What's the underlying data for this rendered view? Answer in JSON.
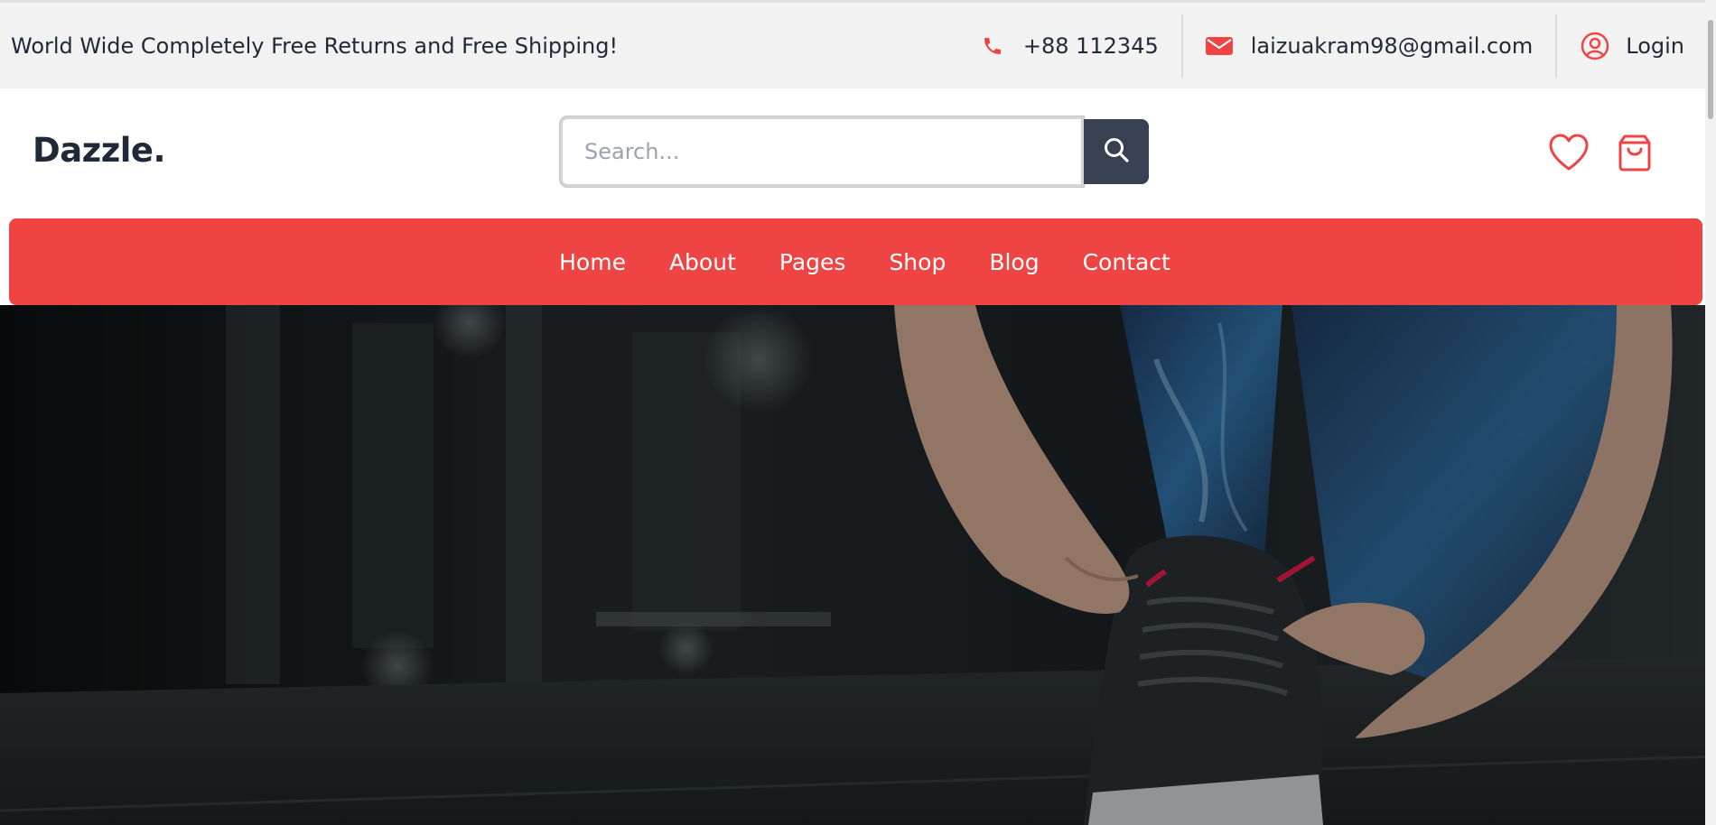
{
  "topbar": {
    "announcement": "World Wide Completely Free Returns and Free Shipping!",
    "phone": {
      "icon": "phone-icon",
      "text": "+88 112345"
    },
    "email": {
      "icon": "envelope-icon",
      "text": "laizuakram98@gmail.com"
    },
    "login": {
      "icon": "user-circle-icon",
      "label": "Login"
    }
  },
  "header": {
    "logo": "Dazzle.",
    "search": {
      "placeholder": "Search...",
      "value": "",
      "button_icon": "search-icon"
    },
    "icons": [
      "heart-icon",
      "shopping-bag-icon"
    ]
  },
  "nav": {
    "items": [
      "Home",
      "About",
      "Pages",
      "Shop",
      "Blog",
      "Contact"
    ]
  },
  "hero": {
    "image": "photo-person-tying-sneaker-laces"
  },
  "colors": {
    "accent": "#ef4444",
    "dark": "#374151",
    "topbar_bg": "#f2f2f2",
    "text": "#1f2937"
  }
}
